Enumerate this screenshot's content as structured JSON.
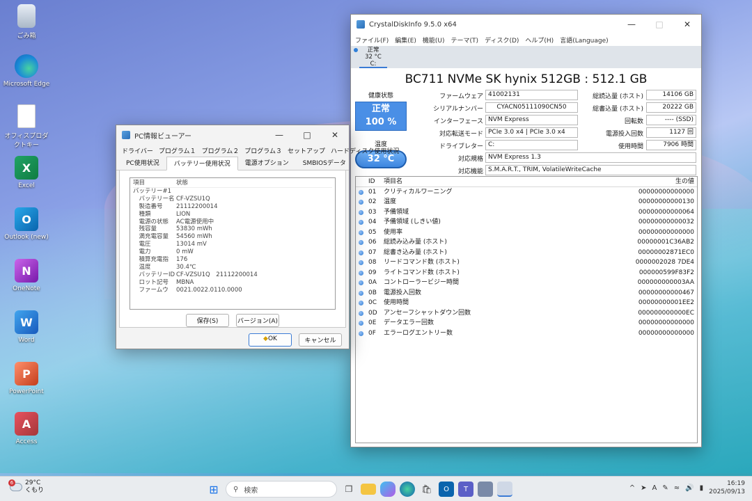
{
  "desktop": {
    "icons": [
      {
        "label": "ごみ箱"
      },
      {
        "label": "Microsoft Edge"
      },
      {
        "label": "オフィスプロダクトキー"
      },
      {
        "label": "Excel",
        "glyph": "X"
      },
      {
        "label": "Outlook (new)",
        "glyph": "O"
      },
      {
        "label": "OneNote",
        "glyph": "N"
      },
      {
        "label": "Word",
        "glyph": "W"
      },
      {
        "label": "PowerPoint",
        "glyph": "P"
      },
      {
        "label": "Access",
        "glyph": "A"
      }
    ]
  },
  "pcinfo": {
    "title": "PC情報ビューアー",
    "tabs_row1": [
      "ドライバー",
      "プログラム１",
      "プログラム２",
      "プログラム３",
      "セットアップ",
      "ハードディスク使用状況"
    ],
    "tabs_row2": [
      "PC使用状況",
      "バッテリー使用状況",
      "電源オプション",
      "SMBIOSデータ"
    ],
    "list_header": {
      "k": "項目",
      "v": "状態"
    },
    "rows": [
      {
        "k": "バッテリー#1",
        "v": ""
      },
      {
        "k": "　バッテリー名",
        "v": "CF-VZSU1Q"
      },
      {
        "k": "　製造番号",
        "v": "21112200014"
      },
      {
        "k": "　種類",
        "v": "LION"
      },
      {
        "k": "　電源の状態",
        "v": "AC電源使用中"
      },
      {
        "k": "　残容量",
        "v": "53830 mWh"
      },
      {
        "k": "　満充電容量",
        "v": "54560 mWh"
      },
      {
        "k": "　電圧",
        "v": "13014 mV"
      },
      {
        "k": "　電力",
        "v": "0 mW"
      },
      {
        "k": "　積算充電指",
        "v": "176"
      },
      {
        "k": "　温度",
        "v": "30.4℃"
      },
      {
        "k": "　バッテリーID",
        "v": "CF-VZSU1Q　21112200014"
      },
      {
        "k": "　ロット記号",
        "v": "MBNA"
      },
      {
        "k": "　ファームウ",
        "v": "0021.0022.0110.0000"
      }
    ],
    "save_label": "保存(S)",
    "version_label": "バージョン(A)",
    "ok_label": "OK",
    "cancel_label": "キャンセル"
  },
  "cdi": {
    "title": "CrystalDiskInfo 9.5.0 x64",
    "menu": [
      "ファイル(F)",
      "編集(E)",
      "機能(U)",
      "テーマ(T)",
      "ディスク(D)",
      "ヘルプ(H)",
      "言語(Language)"
    ],
    "drive_tab": {
      "status": "正常",
      "temp": "32 °C",
      "letter": "C:"
    },
    "model": "BC711 NVMe SK hynix 512GB : 512.1 GB",
    "health_label": "健康状態",
    "health_status": "正常",
    "health_percent": "100 %",
    "temp_label": "温度",
    "temp_value": "32 °C",
    "fields": {
      "firmware_label": "ファームウェア",
      "firmware": "41002131",
      "serial_label": "シリアルナンバー",
      "serial": "CYACN05111090CN50",
      "interface_label": "インターフェース",
      "interface": "NVM Express",
      "transfer_label": "対応転送モード",
      "transfer": "PCIe 3.0 x4 | PCIe 3.0 x4",
      "letter_label": "ドライブレター",
      "letter": "C:",
      "standard_label": "対応規格",
      "standard": "NVM Express 1.3",
      "features_label": "対応機能",
      "features": "S.M.A.R.T., TRIM, VolatileWriteCache",
      "reads_label": "総読込量 (ホスト)",
      "reads": "14106 GB",
      "writes_label": "総書込量 (ホスト)",
      "writes": "20222 GB",
      "rpm_label": "回転数",
      "rpm": "---- (SSD)",
      "power_count_label": "電源投入回数",
      "power_count": "1127 回",
      "hours_label": "使用時間",
      "hours": "7906 時間"
    },
    "smart_header": {
      "id": "ID",
      "name": "項目名",
      "raw": "生の値"
    },
    "smart": [
      {
        "id": "01",
        "name": "クリティカルワーニング",
        "raw": "00000000000000"
      },
      {
        "id": "02",
        "name": "温度",
        "raw": "00000000000130"
      },
      {
        "id": "03",
        "name": "予備領域",
        "raw": "00000000000064"
      },
      {
        "id": "04",
        "name": "予備領域 (しきい値)",
        "raw": "00000000000032"
      },
      {
        "id": "05",
        "name": "使用率",
        "raw": "00000000000000"
      },
      {
        "id": "06",
        "name": "総読み込み量 (ホスト)",
        "raw": "00000001C36AB2"
      },
      {
        "id": "07",
        "name": "総書き込み量 (ホスト)",
        "raw": "00000002871EC0"
      },
      {
        "id": "08",
        "name": "リードコマンド数 (ホスト)",
        "raw": "0000002028 7DE4"
      },
      {
        "id": "09",
        "name": "ライトコマンド数 (ホスト)",
        "raw": "000000599F83F2"
      },
      {
        "id": "0A",
        "name": "コントローラービジー時間",
        "raw": "000000000003AA"
      },
      {
        "id": "0B",
        "name": "電源投入回数",
        "raw": "00000000000467"
      },
      {
        "id": "0C",
        "name": "使用時間",
        "raw": "00000000001EE2"
      },
      {
        "id": "0D",
        "name": "アンセーフシャットダウン回数",
        "raw": "000000000000EC"
      },
      {
        "id": "0E",
        "name": "データエラー回数",
        "raw": "00000000000000"
      },
      {
        "id": "0F",
        "name": "エラーログエントリー数",
        "raw": "00000000000000"
      }
    ]
  },
  "taskbar": {
    "weather_temp": "29°C",
    "weather_text": "くもり",
    "weather_badge": "6",
    "search_placeholder": "検索",
    "time": "16:19",
    "date": "2025/09/13"
  }
}
